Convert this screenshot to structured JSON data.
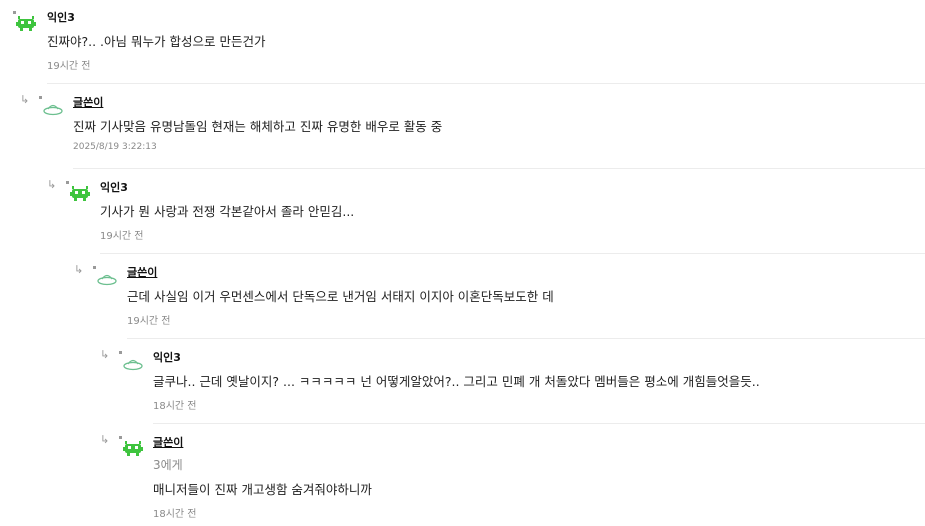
{
  "colors": {
    "avatar_bright": "#3ec43e",
    "avatar_light": "#6cbf8f",
    "divider": "#ececec"
  },
  "comments": [
    {
      "nickname": "익인3",
      "text": "진짜야?.. .아님 뭐누가 합성으로 만든건가",
      "time": "19시간 전",
      "avatar_icon": "green-monster-icon"
    },
    {
      "nickname": "글쓴이",
      "text": "진짜 기사맞음 유명남돌임 현재는 해체하고 진짜 유명한 배우로 활동 중",
      "time": "2025/8/19 3:22:13",
      "avatar_icon": "ufo-icon"
    },
    {
      "nickname": "익인3",
      "text": "기사가 뭔 사랑과 전쟁 각본같아서 졸라 안믿김...",
      "time": "19시간 전",
      "avatar_icon": "green-monster-icon"
    },
    {
      "nickname": "글쓴이",
      "text": "근데 사실임 이거 우먼센스에서 단독으로 낸거임 서태지 이지아 이혼단독보도한 데",
      "time": "19시간 전",
      "avatar_icon": "ufo-icon"
    },
    {
      "nickname": "익인3",
      "text": "글쿠나.. 근데 옛날이지? ... ㅋㅋㅋㅋㅋ 넌 어떻게알았어?.. 그리고 민폐 개 처돌았다 멤버들은 평소에 개힘들엇을듯..",
      "time": "18시간 전",
      "avatar_icon": "ufo-icon"
    },
    {
      "nickname": "글쓴이",
      "mention": "3에게",
      "text": "매니저들이 진짜 개고생함 숨겨줘야하니까",
      "time": "18시간 전",
      "avatar_icon": "green-monster-icon"
    }
  ]
}
